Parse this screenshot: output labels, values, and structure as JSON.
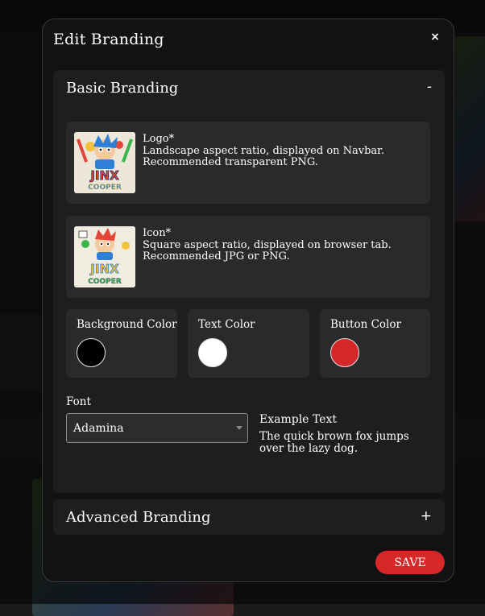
{
  "modal": {
    "title": "Edit Branding",
    "close_label": "×",
    "save_label": "SAVE"
  },
  "basic_branding": {
    "title": "Basic Branding",
    "toggle": "-",
    "logo": {
      "title": "Logo*",
      "line1": "Landscape aspect ratio, displayed on Navbar.",
      "line2": "Recommended transparent PNG."
    },
    "icon": {
      "title": "Icon*",
      "line1": "Square aspect ratio, displayed on browser tab.",
      "line2": "Recommended JPG or PNG."
    },
    "colors": [
      {
        "label": "Background Color",
        "value": "#000000"
      },
      {
        "label": "Text Color",
        "value": "#ffffff"
      },
      {
        "label": "Button Color",
        "value": "#d62729"
      }
    ],
    "font": {
      "label": "Font",
      "selected": "Adamina"
    },
    "example": {
      "title": "Example Text",
      "body": "The quick brown fox jumps over the lazy dog."
    }
  },
  "advanced_branding": {
    "title": "Advanced Branding",
    "toggle": "+"
  },
  "thumbnail_text": {
    "line1": "JINX",
    "line2": "COOPER"
  }
}
